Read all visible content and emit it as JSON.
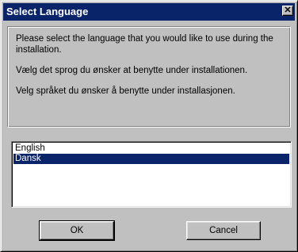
{
  "window": {
    "title": "Select Language",
    "close_glyph": "✕"
  },
  "message": {
    "english": "Please select the language that you would like to use during the installation.",
    "danish": "Vælg det sprog du ønsker at benytte under installationen.",
    "norwegian": "Velg språket du ønsker å benytte under installasjonen."
  },
  "languages": {
    "items": [
      "English",
      "Dansk"
    ],
    "selected": "Dansk"
  },
  "buttons": {
    "ok_label": "OK",
    "cancel_label": "Cancel"
  },
  "colors": {
    "titlebar": "#0a246a",
    "face": "#c0c0c0",
    "selection": "#0a246a"
  }
}
